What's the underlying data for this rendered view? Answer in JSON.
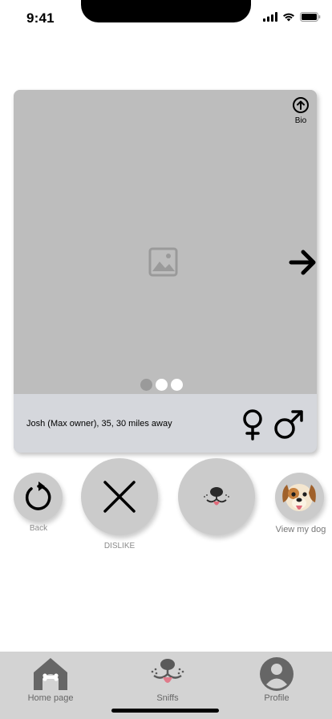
{
  "status_bar": {
    "time": "9:41"
  },
  "card": {
    "bio_label": "Bio",
    "info_text": "Josh (Max owner), 35, 30 miles away",
    "photo_count": 3,
    "active_photo_index": 0
  },
  "actions": {
    "back_label": "Back",
    "dislike_label": "DISLIKE",
    "view_dog_label": "View my dog"
  },
  "tab_bar": {
    "items": [
      {
        "label": "Home page",
        "icon": "dog-house-icon"
      },
      {
        "label": "Sniffs",
        "icon": "dog-nose-icon"
      },
      {
        "label": "Profile",
        "icon": "user-profile-icon"
      }
    ]
  }
}
